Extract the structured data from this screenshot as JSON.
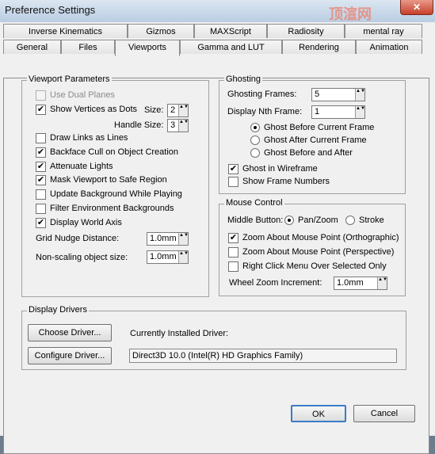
{
  "window": {
    "title": "Preference Settings",
    "close_glyph": "✕",
    "watermark": "顶渲网"
  },
  "tabs_row1": [
    "Inverse Kinematics",
    "Gizmos",
    "MAXScript",
    "Radiosity",
    "mental ray"
  ],
  "tabs_row2": [
    "General",
    "Files",
    "Viewports",
    "Gamma and LUT",
    "Rendering",
    "Animation"
  ],
  "viewport_params": {
    "title": "Viewport Parameters",
    "use_dual_planes": "Use Dual Planes",
    "show_vertices": "Show Vertices as Dots",
    "size_label": "Size:",
    "size_value": "2",
    "handle_size_label": "Handle Size:",
    "handle_size_value": "3",
    "draw_links": "Draw Links as Lines",
    "backface_cull": "Backface Cull on Object Creation",
    "attenuate_lights": "Attenuate Lights",
    "mask_viewport": "Mask Viewport to Safe Region",
    "update_background": "Update Background While Playing",
    "filter_env": "Filter Environment Backgrounds",
    "display_world_axis": "Display World Axis",
    "grid_nudge_label": "Grid Nudge Distance:",
    "grid_nudge_value": "1.0mm",
    "non_scaling_label": "Non-scaling object size:",
    "non_scaling_value": "1.0mm"
  },
  "ghosting": {
    "title": "Ghosting",
    "frames_label": "Ghosting Frames:",
    "frames_value": "5",
    "nth_label": "Display Nth Frame:",
    "nth_value": "1",
    "before": "Ghost Before Current Frame",
    "after": "Ghost After Current Frame",
    "before_after": "Ghost Before and After",
    "wireframe": "Ghost in Wireframe",
    "show_numbers": "Show Frame Numbers"
  },
  "mouse_control": {
    "title": "Mouse Control",
    "middle_button_label": "Middle Button:",
    "pan_zoom": "Pan/Zoom",
    "stroke": "Stroke",
    "zoom_ortho": "Zoom About Mouse Point (Orthographic)",
    "zoom_persp": "Zoom About Mouse Point (Perspective)",
    "right_click": "Right Click Menu Over Selected Only",
    "wheel_zoom_label": "Wheel Zoom Increment:",
    "wheel_zoom_value": "1.0mm"
  },
  "display_drivers": {
    "title": "Display Drivers",
    "choose_driver": "Choose Driver...",
    "configure_driver": "Configure Driver...",
    "installed_label": "Currently Installed Driver:",
    "installed_value": "Direct3D 10.0 (Intel(R) HD Graphics Family)"
  },
  "footer": {
    "ok": "OK",
    "cancel": "Cancel"
  },
  "check_glyph": "✔",
  "arrows_glyph": "▲▼"
}
